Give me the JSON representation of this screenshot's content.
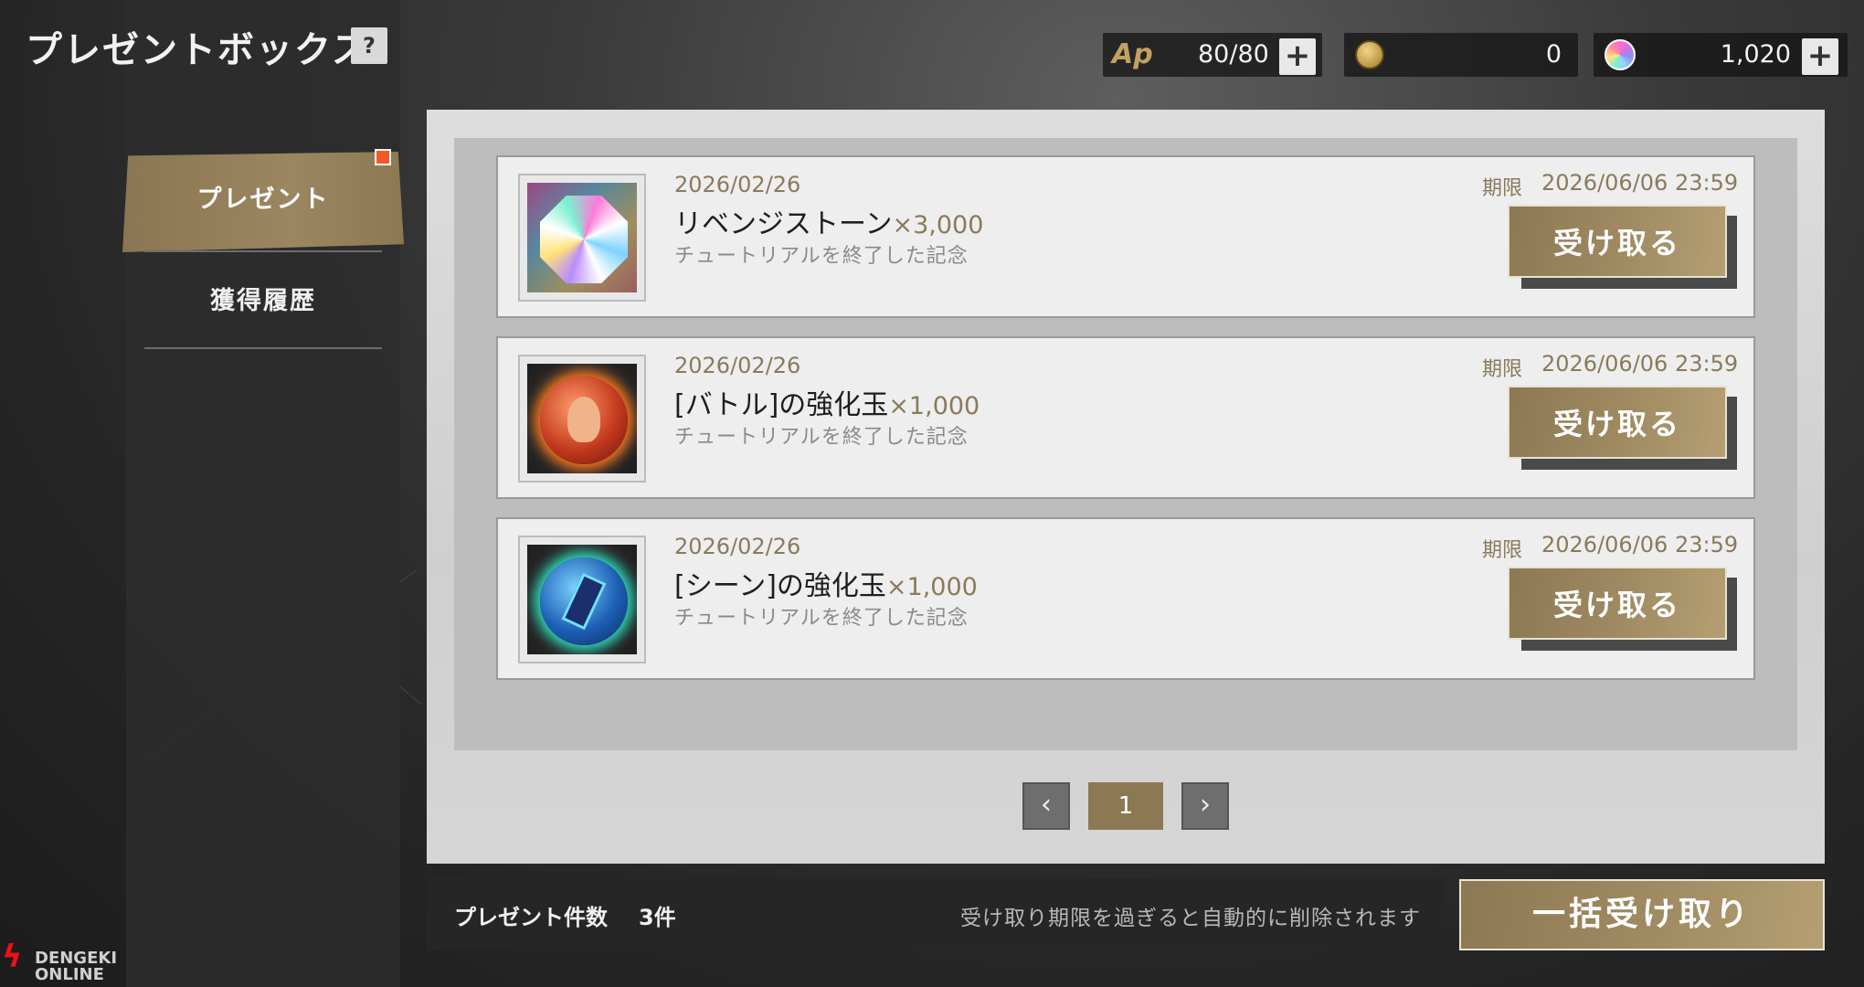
{
  "header": {
    "title": "プレゼントボックス",
    "help_label": "?"
  },
  "resources": {
    "ap": {
      "icon": "ap-icon",
      "icon_label": "Ap",
      "value": "80/80",
      "plus": "+"
    },
    "coin": {
      "icon": "coin-icon",
      "value": "0"
    },
    "gem": {
      "icon": "gem-icon",
      "value": "1,020",
      "plus": "+"
    }
  },
  "sidebar": {
    "items": [
      {
        "label": "プレゼント",
        "active": true
      },
      {
        "label": "獲得履歴",
        "active": false
      }
    ]
  },
  "presents": [
    {
      "date": "2026/02/26",
      "name": "リベンジストーン",
      "qty": "×3,000",
      "note": "チュートリアルを終了した記念",
      "limit_label": "期限",
      "limit_value": "2026/06/06 23:59",
      "button": "受け取る",
      "icon": "revenge-stone-icon"
    },
    {
      "date": "2026/02/26",
      "name": "[バトル]の強化玉",
      "qty": "×1,000",
      "note": "チュートリアルを終了した記念",
      "limit_label": "期限",
      "limit_value": "2026/06/06 23:59",
      "button": "受け取る",
      "icon": "battle-orb-icon"
    },
    {
      "date": "2026/02/26",
      "name": "[シーン]の強化玉",
      "qty": "×1,000",
      "note": "チュートリアルを終了した記念",
      "limit_label": "期限",
      "limit_value": "2026/06/06 23:59",
      "button": "受け取る",
      "icon": "scene-orb-icon"
    }
  ],
  "pagination": {
    "prev": "‹",
    "current": "1",
    "next": "›"
  },
  "footer": {
    "count_label": "プレゼント件数",
    "count_value": "3件",
    "notice": "受け取り期限を過ぎると自動的に削除されます",
    "bulk_button": "一括受け取り"
  },
  "watermark": {
    "line1": "DENGEKI",
    "line2": "ONLINE"
  },
  "colors": {
    "accent_gold": "#9b8660",
    "badge": "#f15a24"
  }
}
